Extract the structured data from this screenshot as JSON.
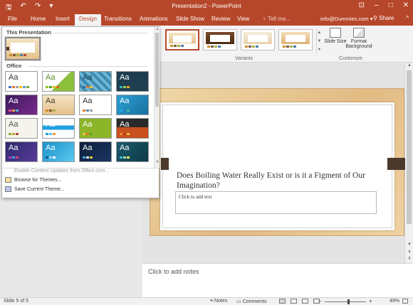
{
  "window": {
    "title": "Presentation2 - PowerPoint",
    "qat": {
      "save_icon": "save-icon",
      "undo_icon": "undo-icon",
      "redo_icon": "redo-icon",
      "customize_icon": "customize-qat-icon"
    },
    "controls": {
      "ribbon_options_icon": "ribbon-display-icon",
      "minimize": "–",
      "maximize": "□",
      "close": "✕"
    }
  },
  "ribbon": {
    "tabs": [
      "File",
      "Home",
      "Insert",
      "Design",
      "Transitions",
      "Animations",
      "Slide Show",
      "Review",
      "View"
    ],
    "active_tab": "Design",
    "tell_me": "Tell me...",
    "account": "info@Dummies.com",
    "share": "Share",
    "groups": {
      "variants": "Variants",
      "customize": "Customize"
    },
    "buttons": {
      "slide_size": "Slide Size",
      "format_background": "Format Background"
    }
  },
  "theme_gallery": {
    "sections": [
      "This Presentation",
      "Office"
    ],
    "theme_label": "Aa",
    "menu": {
      "enable_updates": "Enable Content Updates from Office.com...",
      "browse": "Browse for Themes...",
      "save": "Save Current Theme..."
    }
  },
  "slide": {
    "title": "Does Boiling Water Really Exist or is it a Figment of Our Imagination?",
    "content_placeholder": "Click to add text"
  },
  "notes": {
    "placeholder": "Click to add notes"
  },
  "status": {
    "slide_info": "Slide 5 of 5",
    "notes_label": "Notes",
    "comments_label": "Comments",
    "zoom": "49%"
  },
  "colors": {
    "accent": "#b7472a"
  }
}
